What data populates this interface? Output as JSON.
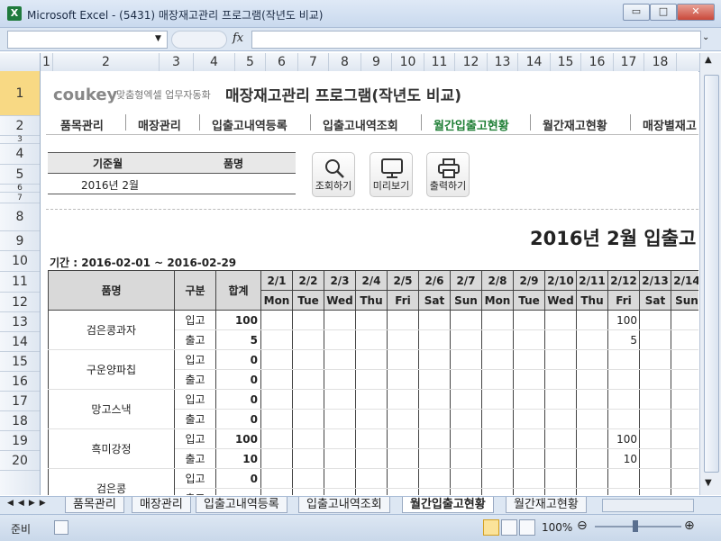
{
  "window": {
    "title": "Microsoft Excel - (5431) 매장재고관리 프로그램(작년도 비교)",
    "min": "▭",
    "max": "□",
    "close": "✕"
  },
  "formula": {
    "fx": "fx",
    "namebox": "",
    "value": ""
  },
  "columns": [
    "1",
    "2",
    "3",
    "4",
    "5",
    "6",
    "7",
    "8",
    "9",
    "10",
    "11",
    "12",
    "13",
    "14",
    "15",
    "16",
    "17",
    "18"
  ],
  "rows": [
    "1",
    "2",
    "3",
    "4",
    "5",
    "6",
    "7",
    "8",
    "9",
    "10",
    "11",
    "12",
    "13",
    "14",
    "15",
    "16",
    "17",
    "18",
    "19",
    "20"
  ],
  "header": {
    "logo": "coukey",
    "logo_sub": "맞춤형엑셀 업무자동화",
    "title": "매장재고관리 프로그램(작년도 비교)"
  },
  "nav": [
    "품목관리",
    "매장관리",
    "입출고내역등록",
    "입출고내역조회",
    "월간입출고현황",
    "월간재고현황",
    "매장별재고"
  ],
  "filter": {
    "col1": "기준월",
    "col2": "품명",
    "value1": "2016년 2월",
    "value2": ""
  },
  "buttons": {
    "search": "조회하기",
    "preview": "미리보기",
    "print": "출력하기"
  },
  "report_title": "2016년 2월 입출고",
  "period": "기간 : 2016-02-01 ~ 2016-02-29",
  "table": {
    "h_item": "품명",
    "h_type": "구분",
    "h_total": "합계",
    "dates": [
      "2/1",
      "2/2",
      "2/3",
      "2/4",
      "2/5",
      "2/6",
      "2/7",
      "2/8",
      "2/9",
      "2/10",
      "2/11",
      "2/12",
      "2/13",
      "2/14"
    ],
    "days": [
      "Mon",
      "Tue",
      "Wed",
      "Thu",
      "Fri",
      "Sat",
      "Sun",
      "Mon",
      "Tue",
      "Wed",
      "Thu",
      "Fri",
      "Sat",
      "Sun"
    ],
    "items": [
      {
        "name": "검은콩과자",
        "in_total": "100",
        "out_total": "5",
        "in_vals": [
          "",
          "",
          "",
          "",
          "",
          "",
          "",
          "",
          "",
          "",
          "",
          "100",
          "",
          ""
        ],
        "out_vals": [
          "",
          "",
          "",
          "",
          "",
          "",
          "",
          "",
          "",
          "",
          "",
          "5",
          "",
          ""
        ]
      },
      {
        "name": "구운양파칩",
        "in_total": "0",
        "out_total": "0",
        "in_vals": [
          "",
          "",
          "",
          "",
          "",
          "",
          "",
          "",
          "",
          "",
          "",
          "",
          "",
          ""
        ],
        "out_vals": [
          "",
          "",
          "",
          "",
          "",
          "",
          "",
          "",
          "",
          "",
          "",
          "",
          "",
          ""
        ]
      },
      {
        "name": "망고스낵",
        "in_total": "0",
        "out_total": "0",
        "in_vals": [
          "",
          "",
          "",
          "",
          "",
          "",
          "",
          "",
          "",
          "",
          "",
          "",
          "",
          ""
        ],
        "out_vals": [
          "",
          "",
          "",
          "",
          "",
          "",
          "",
          "",
          "",
          "",
          "",
          "",
          "",
          ""
        ]
      },
      {
        "name": "흑미강정",
        "in_total": "100",
        "out_total": "10",
        "in_vals": [
          "",
          "",
          "",
          "",
          "",
          "",
          "",
          "",
          "",
          "",
          "",
          "100",
          "",
          ""
        ],
        "out_vals": [
          "",
          "",
          "",
          "",
          "",
          "",
          "",
          "",
          "",
          "",
          "",
          "10",
          "",
          ""
        ]
      },
      {
        "name": "검은콩",
        "in_total": "0",
        "out_total": "",
        "in_vals": [
          "",
          "",
          "",
          "",
          "",
          "",
          "",
          "",
          "",
          "",
          "",
          "",
          "",
          ""
        ],
        "out_vals": [
          "",
          "",
          "",
          "",
          "",
          "",
          "",
          "",
          "",
          "",
          "",
          "",
          "",
          ""
        ]
      }
    ],
    "in_label": "입고",
    "out_label": "출고"
  },
  "sheet_tabs": [
    "품목관리",
    "매장관리",
    "입출고내역등록",
    "입출고내역조회",
    "월간입출고현황",
    "월간재고현황"
  ],
  "status": {
    "ready": "준비",
    "zoom": "100%"
  }
}
